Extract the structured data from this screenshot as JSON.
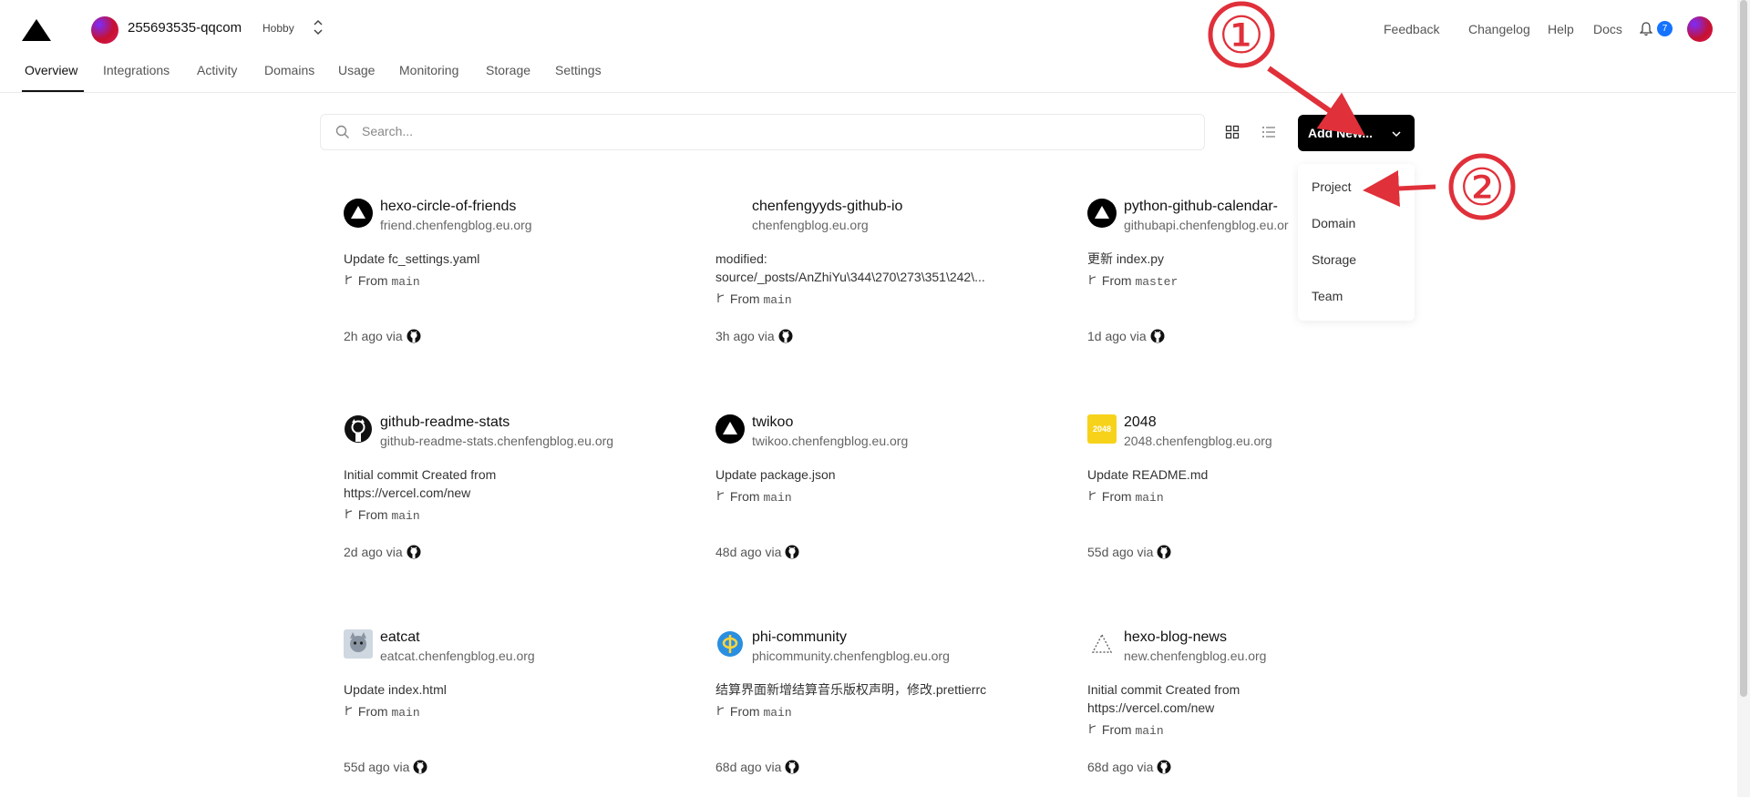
{
  "header": {
    "team_name": "255693535-qqcom",
    "plan": "Hobby",
    "links": {
      "feedback": "Feedback",
      "changelog": "Changelog",
      "help": "Help",
      "docs": "Docs"
    },
    "notification_count": "7"
  },
  "nav": {
    "tabs": [
      "Overview",
      "Integrations",
      "Activity",
      "Domains",
      "Usage",
      "Monitoring",
      "Storage",
      "Settings"
    ],
    "active": "Overview"
  },
  "toolbar": {
    "search_placeholder": "Search...",
    "add_new_label": "Add New..."
  },
  "dropdown": {
    "items": [
      "Project",
      "Domain",
      "Storage",
      "Team"
    ]
  },
  "annotations": {
    "step1": "①",
    "step2": "②"
  },
  "projects": [
    {
      "name": "hexo-circle-of-friends",
      "domain": "friend.chenfengblog.eu.org",
      "commit": "Update fc_settings.yaml",
      "branch_prefix": "From",
      "branch": "main",
      "time": "2h ago via",
      "icon": "vercel-triangle-icon"
    },
    {
      "name": "chenfengyyds-github-io",
      "domain": "chenfengblog.eu.org",
      "commit": "modified:\nsource/_posts/AnZhiYu\\344\\270\\273\\351\\242\\...",
      "branch_prefix": "From",
      "branch": "main",
      "time": "3h ago via",
      "icon": "blank-icon"
    },
    {
      "name": "python-github-calendar-",
      "domain": "githubapi.chenfengblog.eu.or",
      "commit": "更新 index.py",
      "branch_prefix": "From",
      "branch": "master",
      "time": "1d ago via",
      "icon": "vercel-triangle-icon"
    },
    {
      "name": "github-readme-stats",
      "domain": "github-readme-stats.chenfengblog.eu.org",
      "commit": "Initial commit Created from\nhttps://vercel.com/new",
      "branch_prefix": "From",
      "branch": "main",
      "time": "2d ago via",
      "icon": "github-icon"
    },
    {
      "name": "twikoo",
      "domain": "twikoo.chenfengblog.eu.org",
      "commit": "Update package.json",
      "branch_prefix": "From",
      "branch": "main",
      "time": "48d ago via",
      "icon": "vercel-triangle-icon"
    },
    {
      "name": "2048",
      "domain": "2048.chenfengblog.eu.org",
      "commit": "Update README.md",
      "branch_prefix": "From",
      "branch": "main",
      "time": "55d ago via",
      "icon": "2048-tile-icon",
      "icon_text": "2048"
    },
    {
      "name": "eatcat",
      "domain": "eatcat.chenfengblog.eu.org",
      "commit": "Update index.html",
      "branch_prefix": "From",
      "branch": "main",
      "time": "55d ago via",
      "icon": "cat-avatar-icon"
    },
    {
      "name": "phi-community",
      "domain": "phicommunity.chenfengblog.eu.org",
      "commit": "结算界面新增结算音乐版权声明，修改.prettierrc",
      "branch_prefix": "From",
      "branch": "main",
      "time": "68d ago via",
      "icon": "phi-logo-icon"
    },
    {
      "name": "hexo-blog-news",
      "domain": "new.chenfengblog.eu.org",
      "commit": "Initial commit Created from\nhttps://vercel.com/new",
      "branch_prefix": "From",
      "branch": "main",
      "time": "68d ago via",
      "icon": "dotted-triangle-icon"
    }
  ],
  "colors": {
    "accent": "#000000",
    "badge": "#1573ff",
    "annotation": "#e0303a"
  }
}
